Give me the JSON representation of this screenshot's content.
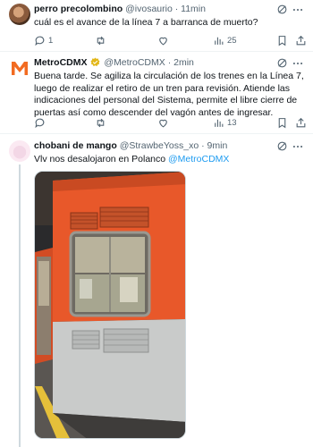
{
  "tweets": [
    {
      "display_name": "perro precolombino",
      "handle": "@ivosaurio",
      "time": "11min",
      "text": "cuál es el avance de la línea 7 a barranca de muerto?",
      "replies": "1",
      "retweets": "",
      "likes": "",
      "views": "25"
    },
    {
      "display_name": "MetroCDMX",
      "handle": "@MetroCDMX",
      "time": "2min",
      "text": "Buena tarde. Se agiliza la circulación de los trenes en la Línea 7, luego de realizar el retiro de un tren para revisión. Atiende las indicaciones del personal del Sistema, permite el libre cierre de puertas así como descender del vagón antes de ingresar.",
      "replies": "",
      "retweets": "",
      "likes": "",
      "views": "13"
    },
    {
      "display_name": "chobani de mango",
      "handle": "@StrawbeYoss_xo",
      "time": "9min",
      "text_plain": "Vlv nos desalojaron en Polanco ",
      "text_mention": "@MetroCDMX"
    }
  ],
  "separator": "·",
  "colors": {
    "accent": "#1d9bf0",
    "verified_gold": "#e2b719",
    "metro_orange": "#f26b21",
    "muted_text": "#536471"
  },
  "icons": [
    "reply-icon",
    "retweet-icon",
    "like-icon",
    "views-icon",
    "bookmark-icon",
    "share-icon",
    "grok-icon",
    "more-icon",
    "verified-badge-icon",
    "metro-logo-icon"
  ]
}
